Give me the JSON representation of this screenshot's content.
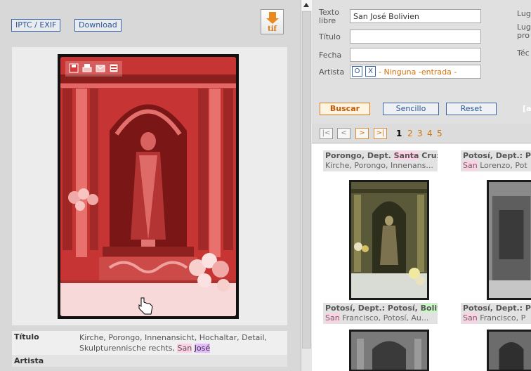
{
  "left": {
    "buttons": {
      "iptc": "IPTC / EXIF",
      "download": "Download",
      "tif": "tif"
    },
    "image_icons": [
      "save-icon",
      "print-icon",
      "email-icon",
      "lightbox-icon"
    ],
    "metadata": {
      "titulo_label": "Título",
      "titulo_value_a": "Kirche, Porongo, Innenansicht, Hochaltar, Detail, Skulpturennische rechts, ",
      "titulo_value_san": "San",
      "titulo_value_sp": " ",
      "titulo_value_jose": "José",
      "artista_label": "Artista"
    }
  },
  "search": {
    "texto_label": "Texto libre",
    "texto_value": "San José Bolivien",
    "titulo_label": "Título",
    "titulo_value": "",
    "fecha_label": "Fecha",
    "fecha_value": "",
    "artista_label": "Artista",
    "artista_o": "O",
    "artista_x": "X",
    "artista_value": "- Ninguna -entrada -",
    "right_labels": [
      "Lug",
      "Lug",
      "pro",
      "Téc"
    ],
    "buscar": "Buscar",
    "sencillo": "Sencillo",
    "reset": "Reset",
    "extra": "[a"
  },
  "pager": {
    "first": "|<",
    "prev": "<",
    "next": ">",
    "last": ">|",
    "current": "1",
    "pages": [
      "2",
      "3",
      "4",
      "5"
    ]
  },
  "results": [
    {
      "title_a": "Porongo, Dept. ",
      "title_hl": "Santa",
      "title_b": " Cruz",
      "sub_a": "Kirche, Porongo, Innenans...",
      "sub_hl": ""
    },
    {
      "title_a": "Potosí, Dept.: Po",
      "title_hl": "",
      "title_b": "",
      "sub_hl": "San",
      "sub_a": " Lorenzo, Pot"
    },
    {
      "title_a": "Potosí, Dept.: Potosí, ",
      "title_hl": "Boliv",
      "title_b": "",
      "sub_hl": "San",
      "sub_a": " Francisco, Potosí, Au..."
    },
    {
      "title_a": "Potosí, Dept.: Po",
      "title_hl": "",
      "title_b": "",
      "sub_hl": "San",
      "sub_a": " Francisco, P"
    }
  ],
  "colors": {
    "accent_orange": "#d07410",
    "link_blue": "#2b5597",
    "photo_red": "#c4312f"
  }
}
